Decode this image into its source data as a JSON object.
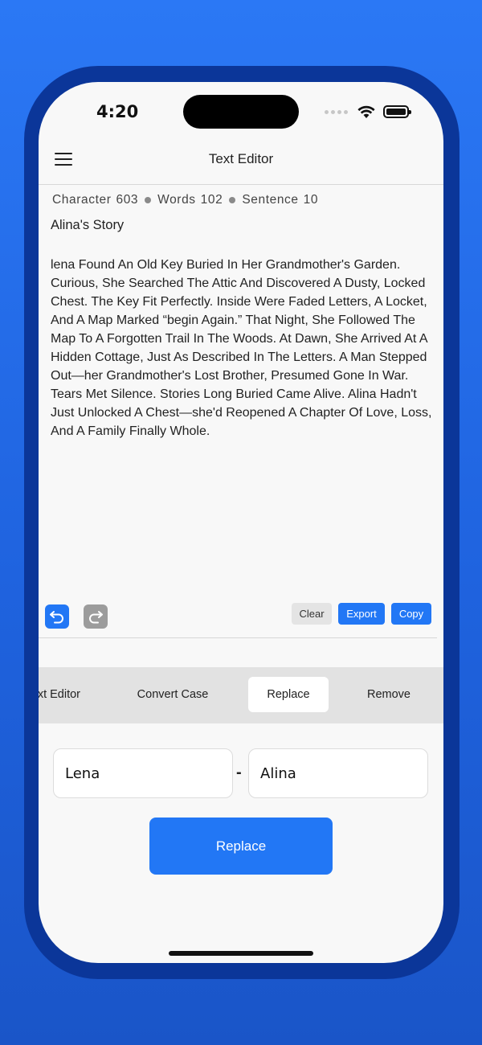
{
  "status_bar": {
    "time": "4:20"
  },
  "header": {
    "title": "Text Editor",
    "menu_icon": "hamburger-menu-icon"
  },
  "stats": {
    "character_label": "Character",
    "character_count": "603",
    "words_label": "Words",
    "words_count": "102",
    "sentence_label": "Sentence",
    "sentence_count": "10"
  },
  "document": {
    "title": "Alina's Story",
    "body": "lena Found An Old Key Buried In Her Grandmother's Garden. Curious, She Searched The Attic And Discovered A Dusty, Locked Chest. The Key Fit Perfectly. Inside Were Faded Letters, A Locket, And A Map Marked “begin Again.” That Night, She Followed The Map To A Forgotten Trail In The Woods. At Dawn, She Arrived At A Hidden Cottage, Just As Described In The Letters. A Man Stepped Out—her Grandmother's Lost Brother, Presumed Gone In War. Tears Met Silence. Stories Long Buried Came Alive. Alina Hadn't Just Unlocked A Chest—she'd Reopened A Chapter Of Love, Loss, And A Family Finally Whole."
  },
  "toolbar": {
    "undo_icon": "undo-icon",
    "redo_icon": "redo-icon",
    "clear_label": "Clear",
    "export_label": "Export",
    "copy_label": "Copy"
  },
  "tabs": [
    {
      "label": "xt Editor",
      "active": false
    },
    {
      "label": "Convert Case",
      "active": false
    },
    {
      "label": "Replace",
      "active": true
    },
    {
      "label": "Remove",
      "active": false
    }
  ],
  "replace_panel": {
    "find_value": "Lena",
    "separator": "-",
    "replace_value": "Alina",
    "button_label": "Replace"
  },
  "colors": {
    "accent": "#2277f5",
    "background": "#1f63df",
    "frame": "#0b3699"
  }
}
